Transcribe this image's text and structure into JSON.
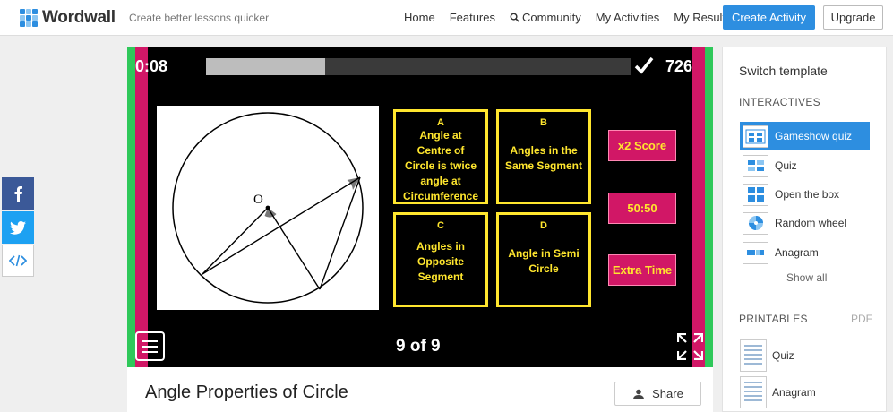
{
  "header": {
    "logo_text": "Wordwall",
    "tagline": "Create better lessons quicker",
    "nav": [
      "Home",
      "Features",
      "Community",
      "My Activities",
      "My Results"
    ],
    "create_label": "Create Activity",
    "upgrade_label": "Upgrade"
  },
  "game": {
    "timer": "0:08",
    "progress": 0.28,
    "score": "726",
    "counter": "9 of 9",
    "point_label": "O",
    "answers": [
      {
        "letter": "A",
        "text": "Angle at Centre of Circle is twice angle at Circumference"
      },
      {
        "letter": "B",
        "text": "Angles in the Same Segment"
      },
      {
        "letter": "C",
        "text": "Angles in Opposite Segment"
      },
      {
        "letter": "D",
        "text": "Angle in Semi Circle"
      }
    ],
    "powerups": [
      "x2 Score",
      "50:50",
      "Extra Time"
    ],
    "colors": {
      "frame_green": "#2fc85a",
      "frame_pink": "#d11766",
      "answer_yellow": "#ffe62e"
    }
  },
  "activity": {
    "title": "Angle Properties of Circle",
    "share_label": "Share"
  },
  "sidebar": {
    "title": "Switch template",
    "interactives_heading": "INTERACTIVES",
    "templates": [
      "Gameshow quiz",
      "Quiz",
      "Open the box",
      "Random wheel",
      "Anagram"
    ],
    "show_all": "Show all",
    "printables_heading": "PRINTABLES",
    "pdf_label": "PDF",
    "printables": [
      "Quiz",
      "Anagram"
    ]
  }
}
